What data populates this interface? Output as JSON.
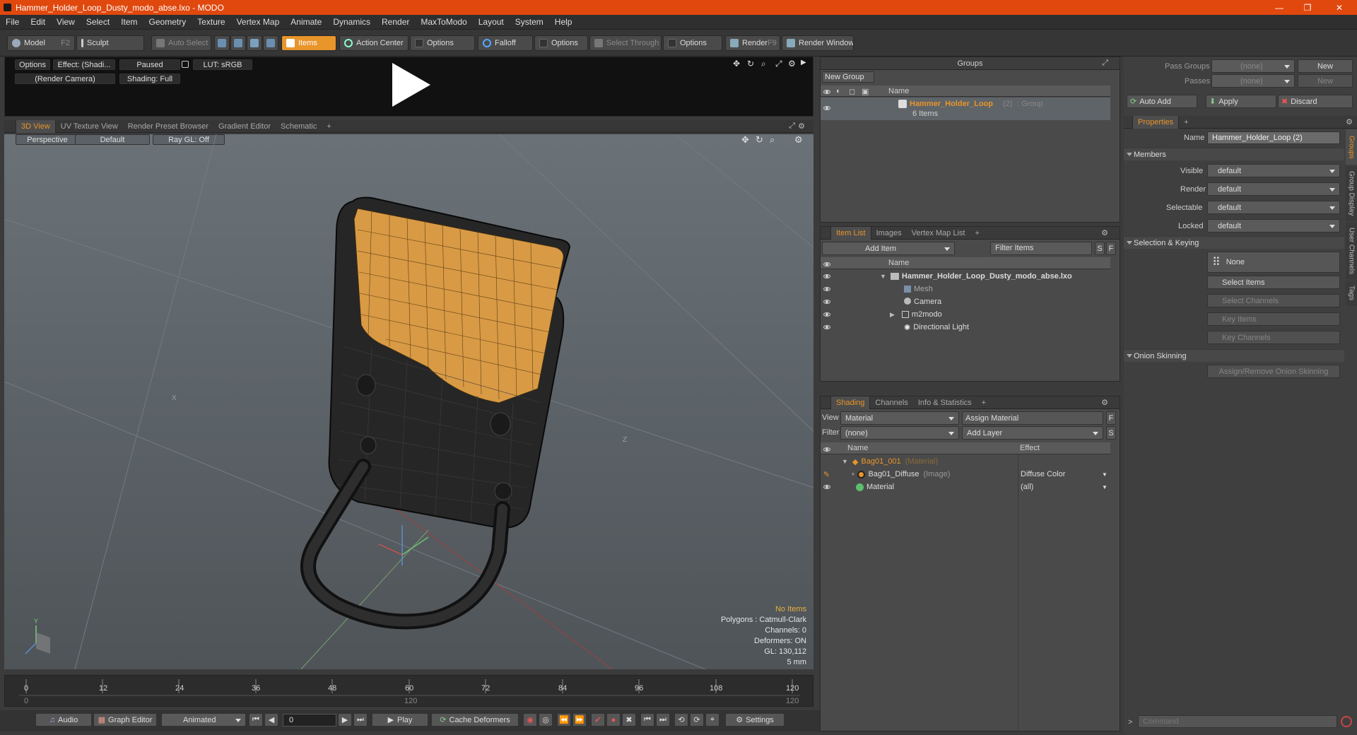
{
  "window": {
    "title": "Hammer_Holder_Loop_Dusty_modo_abse.lxo - MODO",
    "minimize": "—",
    "maximize": "❐",
    "close": "✕"
  },
  "menu": [
    "File",
    "Edit",
    "View",
    "Select",
    "Item",
    "Geometry",
    "Texture",
    "Vertex Map",
    "Animate",
    "Dynamics",
    "Render",
    "MaxToModo",
    "Layout",
    "System",
    "Help"
  ],
  "toolbar": {
    "model": "Model",
    "model_hotkey": "F2",
    "sculpt": "Sculpt",
    "auto_select": "Auto Select",
    "items": "Items",
    "action_center": "Action Center",
    "options1": "Options",
    "falloff": "Falloff",
    "options2": "Options",
    "select_through": "Select Through",
    "options3": "Options",
    "render": "Render",
    "render_hotkey": "F9",
    "render_window": "Render Window"
  },
  "preview": {
    "options": "Options",
    "effect": "Effect: (Shadi...",
    "paused": "Paused",
    "lut": "LUT: sRGB",
    "camera": "(Render Camera)",
    "shading": "Shading: Full"
  },
  "view_tabs": [
    "3D View",
    "UV Texture View",
    "Render Preset Browser",
    "Gradient Editor",
    "Schematic",
    "+"
  ],
  "viewport": {
    "projection": "Perspective",
    "style": "Default",
    "raygl": "Ray GL: Off",
    "info": {
      "no_items": "No Items",
      "polygons": "Polygons : Catmull-Clark",
      "channels": "Channels: 0",
      "deformers": "Deformers: ON",
      "gl": "GL: 130,112",
      "scale": "5 mm"
    },
    "axis_x": "X",
    "axis_y": "Y",
    "axis_z": "Z"
  },
  "timeline": {
    "ticks": [
      "0",
      "12",
      "24",
      "36",
      "48",
      "60",
      "72",
      "84",
      "96",
      "108",
      "120"
    ],
    "start": "0",
    "mid": "120",
    "end": "120"
  },
  "bottombar": {
    "audio": "Audio",
    "graph_editor": "Graph Editor",
    "animated": "Animated",
    "frame": "0",
    "play": "Play",
    "cache_deformers": "Cache Deformers",
    "settings": "Settings"
  },
  "groups": {
    "header": "Groups",
    "new_group": "New Group",
    "col_name": "Name",
    "item_name": "Hammer_Holder_Loop",
    "item_count": "(2)",
    "item_type": ": Group",
    "item_sub": "6 Items"
  },
  "itemlist": {
    "tabs": [
      "Item List",
      "Images",
      "Vertex Map List",
      "+"
    ],
    "add_item": "Add Item",
    "filter": "Filter Items",
    "s": "S",
    "f": "F",
    "col_name": "Name",
    "rows": [
      {
        "name": "Hammer_Holder_Loop_Dusty_modo_abse.lxo"
      },
      {
        "name": "Mesh"
      },
      {
        "name": "Camera"
      },
      {
        "name": "m2modo"
      },
      {
        "name": "Directional Light"
      }
    ]
  },
  "shading": {
    "tabs": [
      "Shading",
      "Channels",
      "Info & Statistics",
      "+"
    ],
    "view_label": "View",
    "view_value": "Material",
    "assign_material": "Assign Material",
    "f": "F",
    "filter_label": "Filter",
    "filter_value": "(none)",
    "add_layer": "Add Layer",
    "s": "S",
    "col_name": "Name",
    "col_effect": "Effect",
    "rows": [
      {
        "name": "Bag01_001",
        "type": "(Material)",
        "effect": ""
      },
      {
        "name": "Bag01_Diffuse",
        "type": "(Image)",
        "effect": "Diffuse Color"
      },
      {
        "name": "Material",
        "type": "",
        "effect": "(all)"
      }
    ]
  },
  "right": {
    "pass_groups_label": "Pass Groups",
    "pass_groups_value": "(none)",
    "new1": "New",
    "passes_label": "Passes",
    "passes_value": "(none)",
    "new2": "New",
    "auto_add": "Auto Add",
    "apply": "Apply",
    "discard": "Discard",
    "properties_tab": "Properties",
    "plus": "+",
    "name_label": "Name",
    "name_value": "Hammer_Holder_Loop (2)",
    "members": "Members",
    "visible_label": "Visible",
    "visible_value": "default",
    "render_label": "Render",
    "render_value": "default",
    "selectable_label": "Selectable",
    "selectable_value": "default",
    "locked_label": "Locked",
    "locked_value": "default",
    "selection_keying": "Selection & Keying",
    "none": "None",
    "select_items": "Select Items",
    "select_channels": "Select Channels",
    "key_items": "Key Items",
    "key_channels": "Key Channels",
    "onion_skinning": "Onion Skinning",
    "assign_onion": "Assign/Remove Onion Skinning",
    "vtabs": [
      "Groups",
      "Group Display",
      "User Channels",
      "Tags"
    ],
    "command_placeholder": "Command"
  },
  "colors": {
    "accent": "#e8952a",
    "titlebar": "#e0480e",
    "mesh_top": "#d99a45"
  }
}
